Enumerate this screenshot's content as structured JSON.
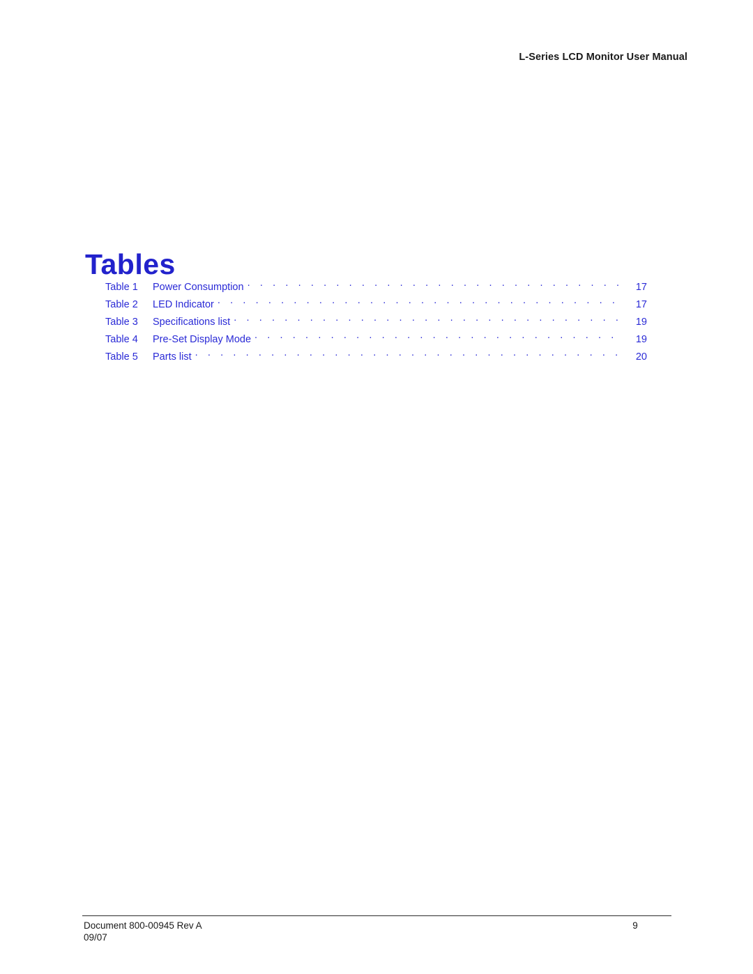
{
  "header": {
    "running_title": "L-Series LCD Monitor User Manual"
  },
  "title": "Tables",
  "toc": {
    "entries": [
      {
        "label": "Table 1",
        "title": "Power Consumption",
        "page": "17"
      },
      {
        "label": "Table 2",
        "title": "LED Indicator",
        "page": "17"
      },
      {
        "label": "Table 3",
        "title": "Specifications list",
        "page": "19"
      },
      {
        "label": "Table 4",
        "title": "Pre-Set Display Mode",
        "page": "19"
      },
      {
        "label": "Table 5",
        "title": "Parts list",
        "page": "20"
      }
    ]
  },
  "footer": {
    "document_id": "Document 800-00945 Rev A",
    "date": "09/07",
    "page_number": "9"
  },
  "colors": {
    "link_blue": "#2a2ad6",
    "title_blue": "#2222cc",
    "body_text": "#1a1a1a"
  }
}
